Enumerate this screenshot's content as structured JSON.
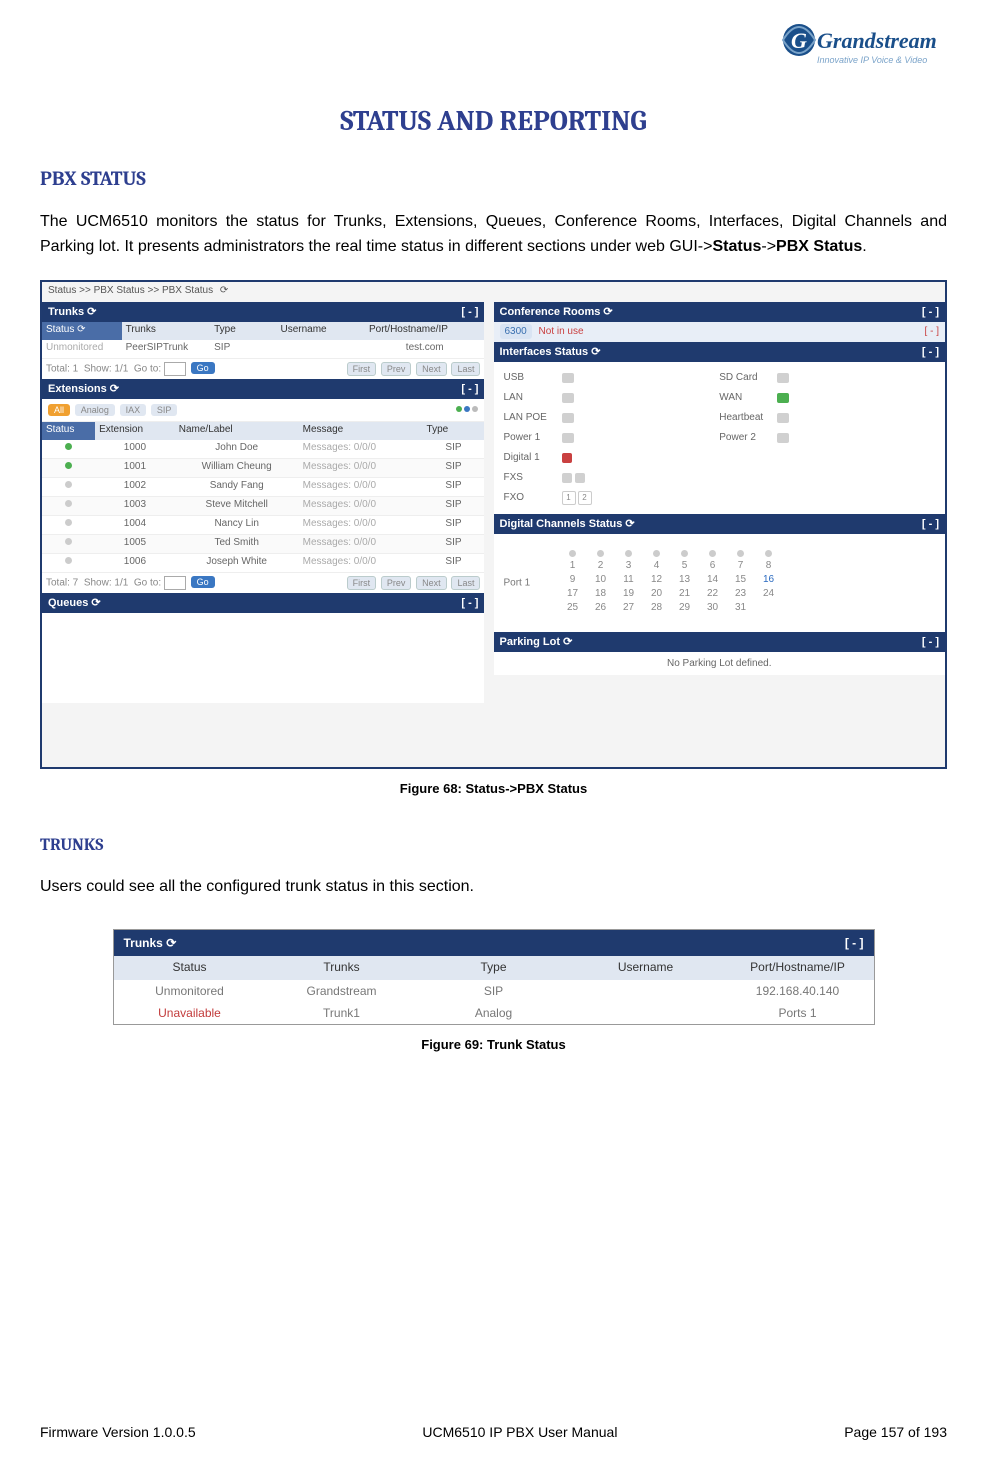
{
  "logo": {
    "main": "Grandstream",
    "sub": "Innovative IP Voice & Video"
  },
  "page_title": "STATUS AND REPORTING",
  "sec_pbx_status": "PBX STATUS",
  "para1_a": "The UCM6510 monitors the status for Trunks, Extensions, Queues, Conference Rooms, Interfaces, Digital Channels and Parking lot. It presents administrators the real time status in different sections under web GUI->",
  "para1_b": "Status",
  "para1_c": "->",
  "para1_d": "PBX Status",
  "para1_e": ".",
  "fig68_caption": "Figure 68: Status->PBX Status",
  "fig68": {
    "breadcrumb": "Status >> PBX Status >> PBX Status",
    "trunks": {
      "title": "Trunks",
      "collapse": "[ - ]",
      "cols": {
        "status": "Status",
        "trunks": "Trunks",
        "type": "Type",
        "username": "Username",
        "host": "Port/Hostname/IP"
      },
      "row": {
        "status": "Unmonitored",
        "trunks": "PeerSIPTrunk",
        "type": "SIP",
        "username": "",
        "host": "test.com"
      },
      "total": "Total: 1",
      "show": "Show: 1/1",
      "goto": "Go to:",
      "first": "First",
      "prev": "Prev",
      "next": "Next",
      "last": "Last",
      "go": "Go"
    },
    "extensions": {
      "title": "Extensions",
      "collapse": "[ - ]",
      "tabs": {
        "all": "All",
        "analog": "Analog",
        "iax": "IAX",
        "sip": "SIP"
      },
      "cols": {
        "status": "Status",
        "ext": "Extension",
        "name": "Name/Label",
        "msg": "Message",
        "type": "Type"
      },
      "rows": [
        {
          "on": true,
          "ext": "1000",
          "name": "John Doe",
          "msg": "Messages: 0/0/0",
          "type": "SIP"
        },
        {
          "on": true,
          "ext": "1001",
          "name": "William Cheung",
          "msg": "Messages: 0/0/0",
          "type": "SIP"
        },
        {
          "on": false,
          "ext": "1002",
          "name": "Sandy Fang",
          "msg": "Messages: 0/0/0",
          "type": "SIP"
        },
        {
          "on": false,
          "ext": "1003",
          "name": "Steve Mitchell",
          "msg": "Messages: 0/0/0",
          "type": "SIP"
        },
        {
          "on": false,
          "ext": "1004",
          "name": "Nancy Lin",
          "msg": "Messages: 0/0/0",
          "type": "SIP"
        },
        {
          "on": false,
          "ext": "1005",
          "name": "Ted Smith",
          "msg": "Messages: 0/0/0",
          "type": "SIP"
        },
        {
          "on": false,
          "ext": "1006",
          "name": "Joseph White",
          "msg": "Messages: 0/0/0",
          "type": "SIP"
        }
      ],
      "total": "Total: 7",
      "show": "Show: 1/1",
      "goto": "Go to:",
      "first": "First",
      "prev": "Prev",
      "next": "Next",
      "last": "Last",
      "go": "Go"
    },
    "queues": {
      "title": "Queues",
      "collapse": "[ - ]"
    },
    "conference": {
      "title": "Conference Rooms",
      "collapse": "[ - ]",
      "num": "6300",
      "msg": "Not in use"
    },
    "interfaces": {
      "title": "Interfaces Status",
      "collapse": "[ - ]",
      "usb": "USB",
      "sdcard": "SD Card",
      "lan": "LAN",
      "wan": "WAN",
      "lanpoe": "LAN POE",
      "heartbeat": "Heartbeat",
      "power1": "Power 1",
      "power2": "Power 2",
      "digital1": "Digital 1",
      "fxs": "FXS",
      "fxo": "FXO"
    },
    "digital": {
      "title": "Digital Channels Status",
      "collapse": "[ - ]",
      "port": "Port 1",
      "blue": "16"
    },
    "parking": {
      "title": "Parking Lot",
      "collapse": "[ - ]",
      "msg": "No Parking Lot defined."
    }
  },
  "sec_trunks": "TRUNKS",
  "para2": "Users could see all the configured trunk status in this section.",
  "fig69_caption": "Figure 69: Trunk Status",
  "fig69": {
    "title": "Trunks",
    "collapse": "[ - ]",
    "cols": {
      "status": "Status",
      "trunks": "Trunks",
      "type": "Type",
      "username": "Username",
      "host": "Port/Hostname/IP"
    },
    "r1": {
      "status": "Unmonitored",
      "trunks": "Grandstream",
      "type": "SIP",
      "username": "",
      "host": "192.168.40.140"
    },
    "r2": {
      "status": "Unavailable",
      "trunks": "Trunk1",
      "type": "Analog",
      "username": "",
      "host": "Ports 1"
    }
  },
  "footer": {
    "left": "Firmware Version 1.0.0.5",
    "mid": "UCM6510 IP PBX User Manual",
    "right": "Page 157 of 193"
  }
}
